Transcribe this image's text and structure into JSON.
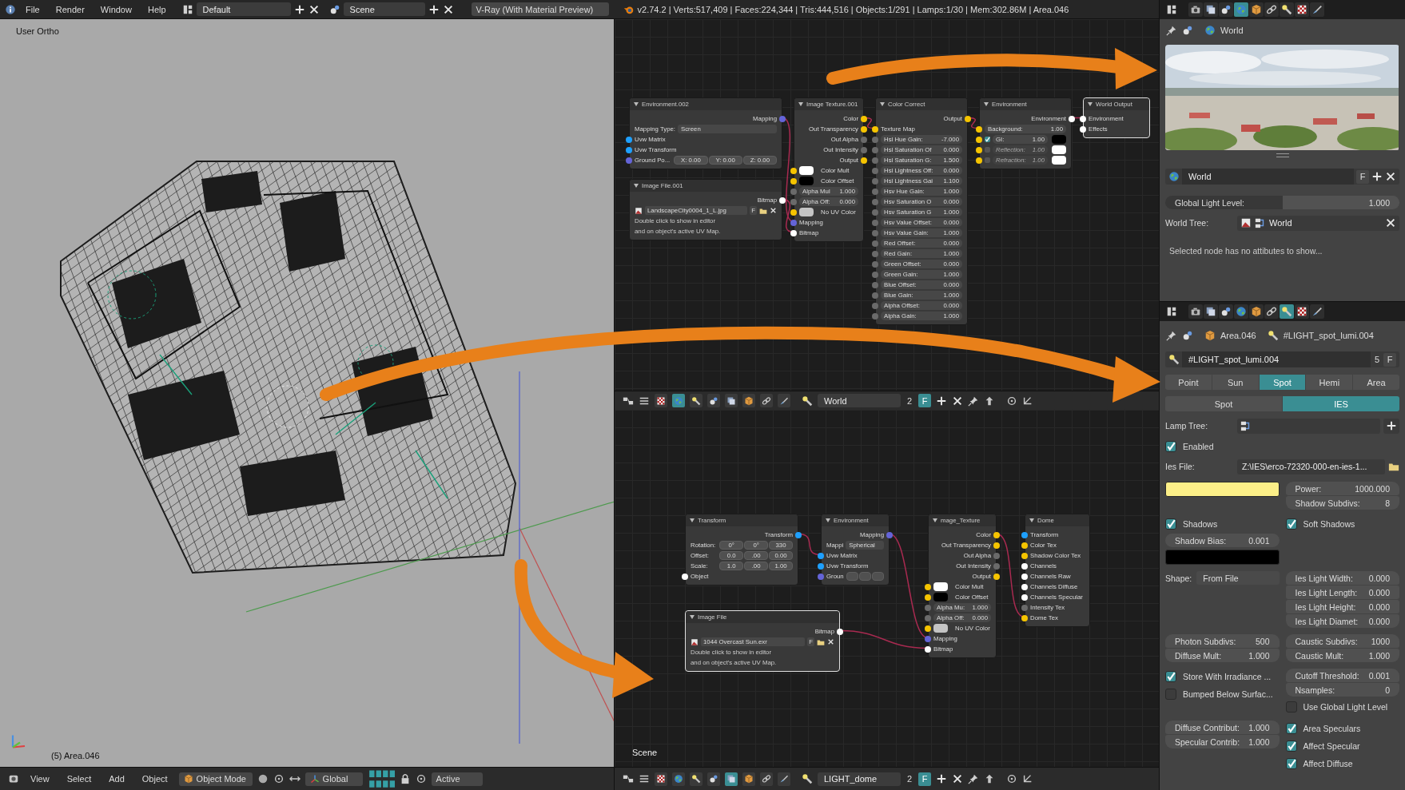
{
  "top_bar": {
    "menus": [
      "File",
      "Render",
      "Window",
      "Help"
    ],
    "layout": "Default",
    "scene": "Scene",
    "engine": "V-Ray (With Material Preview)",
    "stats": "v2.74.2 | Verts:517,409 | Faces:224,344 | Tris:444,516 | Objects:1/291 | Lamps:1/30 | Mem:302.86M | Area.046"
  },
  "viewport": {
    "view_name": "User Ortho",
    "object_info": "(5) Area.046",
    "footer": {
      "menus": [
        "View",
        "Select",
        "Add",
        "Object"
      ],
      "mode": "Object Mode",
      "orientation": "Global",
      "pivot": "Active"
    }
  },
  "node_editors": [
    {
      "nodes": [
        {
          "title": "Environment.002",
          "selected": false,
          "rows": [
            {
              "kind": "out",
              "label": "Mapping",
              "socket": {
                "color": "#6464d8"
              }
            },
            {
              "kind": "select",
              "label": "Mapping Type:",
              "value": "Screen"
            },
            {
              "kind": "in",
              "label": "Uvw Matrix",
              "socket": {
                "color": "#1ea0ff"
              }
            },
            {
              "kind": "in",
              "label": "Uvw Transform",
              "socket": {
                "color": "#1ea0ff"
              }
            },
            {
              "kind": "vec",
              "label": "Ground Po...",
              "values": [
                "X: 0.00",
                "Y: 0.00",
                "Z: 0.00"
              ],
              "socket": {
                "color": "#6464d8"
              }
            }
          ]
        },
        {
          "title": "Image File.001",
          "selected": false,
          "rows": [
            {
              "kind": "out",
              "label": "Bitmap",
              "socket": {
                "color": "#ffffff"
              }
            },
            {
              "kind": "file",
              "value": "LandscapeCity0004_1_L.jpg",
              "flag": "F"
            },
            {
              "kind": "note",
              "label": "Double click to show in editor"
            },
            {
              "kind": "note",
              "label": "and on object's active UV Map."
            }
          ]
        },
        {
          "title": "Image Texture.001",
          "selected": false,
          "rows": [
            {
              "kind": "out",
              "label": "Color",
              "socket": {
                "color": "#f5c400"
              }
            },
            {
              "kind": "out",
              "label": "Out Transparency",
              "socket": {
                "color": "#f5c400"
              }
            },
            {
              "kind": "out",
              "label": "Out Alpha",
              "socket": {
                "color": "#6a6a6a"
              }
            },
            {
              "kind": "out",
              "label": "Out Intensity",
              "socket": {
                "color": "#6a6a6a"
              }
            },
            {
              "kind": "out",
              "label": "Output",
              "socket": {
                "color": "#f5c400"
              }
            },
            {
              "kind": "swatch",
              "label": "Color Mult",
              "swatch": {
                "color": "#ffffff"
              },
              "socket": {
                "color": "#f5c400"
              }
            },
            {
              "kind": "swatch",
              "label": "Color Offset",
              "swatch": {
                "color": "#000000"
              },
              "socket": {
                "color": "#f5c400"
              }
            },
            {
              "kind": "prop",
              "label": "Alpha Mul",
              "value": "1.000",
              "socket": {
                "color": "#6a6a6a"
              }
            },
            {
              "kind": "prop",
              "label": "Alpha Off:",
              "value": "0.000",
              "socket": {
                "color": "#6a6a6a"
              }
            },
            {
              "kind": "swatch",
              "label": "No UV Color",
              "swatch": {
                "color": "#c4c4c4"
              },
              "socket": {
                "color": "#f5c400"
              }
            },
            {
              "kind": "in",
              "label": "Mapping",
              "socket": {
                "color": "#6464d8"
              }
            },
            {
              "kind": "in",
              "label": "Bitmap",
              "socket": {
                "color": "#ffffff"
              }
            }
          ]
        },
        {
          "title": "Color Correct",
          "selected": false,
          "rows": [
            {
              "kind": "out",
              "label": "Output",
              "socket": {
                "color": "#f5c400"
              }
            },
            {
              "kind": "in",
              "label": "Texture Map",
              "socket": {
                "color": "#f5c400"
              }
            },
            {
              "kind": "prop",
              "label": "Hsl Hue Gain:",
              "value": "-7.000",
              "socket": {
                "color": "#6a6a6a"
              }
            },
            {
              "kind": "prop",
              "label": "Hsl Saturation Of",
              "value": "0.000",
              "socket": {
                "color": "#6a6a6a"
              }
            },
            {
              "kind": "prop",
              "label": "Hsl Saturation G:",
              "value": "1.500",
              "socket": {
                "color": "#6a6a6a"
              }
            },
            {
              "kind": "prop",
              "label": "Hsl Lightness Off:",
              "value": "0.000",
              "socket": {
                "color": "#6a6a6a"
              }
            },
            {
              "kind": "prop",
              "label": "Hsl Lightness Gai",
              "value": "1.100",
              "socket": {
                "color": "#6a6a6a"
              }
            },
            {
              "kind": "prop",
              "label": "Hsv Hue Gain:",
              "value": "1.000",
              "socket": {
                "color": "#6a6a6a"
              }
            },
            {
              "kind": "prop",
              "label": "Hsv Saturation O",
              "value": "0.000",
              "socket": {
                "color": "#6a6a6a"
              }
            },
            {
              "kind": "prop",
              "label": "Hsv Saturation G",
              "value": "1.000",
              "socket": {
                "color": "#6a6a6a"
              }
            },
            {
              "kind": "prop",
              "label": "Hsv Value Offset:",
              "value": "0.000",
              "socket": {
                "color": "#6a6a6a"
              }
            },
            {
              "kind": "prop",
              "label": "Hsv Value Gain:",
              "value": "1.000",
              "socket": {
                "color": "#6a6a6a"
              }
            },
            {
              "kind": "prop",
              "label": "Red Offset:",
              "value": "0.000",
              "socket": {
                "color": "#6a6a6a"
              }
            },
            {
              "kind": "prop",
              "label": "Red Gain:",
              "value": "1.000",
              "socket": {
                "color": "#6a6a6a"
              }
            },
            {
              "kind": "prop",
              "label": "Green Offset:",
              "value": "0.000",
              "socket": {
                "color": "#6a6a6a"
              }
            },
            {
              "kind": "prop",
              "label": "Green Gain:",
              "value": "1.000",
              "socket": {
                "color": "#6a6a6a"
              }
            },
            {
              "kind": "prop",
              "label": "Blue Offset:",
              "value": "0.000",
              "socket": {
                "color": "#6a6a6a"
              }
            },
            {
              "kind": "prop",
              "label": "Blue Gain:",
              "value": "1.000",
              "socket": {
                "color": "#6a6a6a"
              }
            },
            {
              "kind": "prop",
              "label": "Alpha Offset:",
              "value": "0.000",
              "socket": {
                "color": "#6a6a6a"
              }
            },
            {
              "kind": "prop",
              "label": "Alpha Gain:",
              "value": "1.000",
              "socket": {
                "color": "#6a6a6a"
              }
            }
          ]
        },
        {
          "title": "Environment",
          "selected": false,
          "rows": [
            {
              "kind": "out",
              "label": "Environment",
              "socket": {
                "color": "#ffffff"
              }
            },
            {
              "kind": "prop",
              "label": "Background:",
              "value": "1.00",
              "socket": {
                "color": "#f5c400"
              }
            },
            {
              "kind": "toggle",
              "label": "GI:",
              "value": "1.00",
              "checked": true,
              "swatch": {
                "color": "#000000"
              },
              "socket": {
                "color": "#f5c400"
              }
            },
            {
              "kind": "toggle",
              "label": "Reflection:",
              "value": "1.00",
              "checked": false,
              "swatch": {
                "color": "#ffffff"
              },
              "socket": {
                "color": "#f5c400"
              }
            },
            {
              "kind": "toggle",
              "label": "Refraction:",
              "value": "1.00",
              "checked": false,
              "swatch": {
                "color": "#ffffff"
              },
              "socket": {
                "color": "#f5c400"
              }
            }
          ]
        },
        {
          "title": "World Output",
          "selected": true,
          "rows": [
            {
              "kind": "in",
              "label": "Environment",
              "socket": {
                "color": "#ffffff"
              }
            },
            {
              "kind": "in",
              "label": "Effects",
              "socket": {
                "color": "#ffffff"
              }
            }
          ]
        }
      ],
      "header": {
        "tree_types": [
          {
            "kind": "texture",
            "selected": false
          },
          {
            "kind": "world",
            "selected": true
          },
          {
            "kind": "lamp",
            "selected": false
          },
          {
            "kind": "scene",
            "selected": false
          },
          {
            "kind": "layers",
            "selected": false
          },
          {
            "kind": "object",
            "selected": false
          },
          {
            "kind": "constraint",
            "selected": false
          },
          {
            "kind": "particles",
            "selected": false
          }
        ],
        "datablock": "World",
        "users": "2",
        "fake_user": "F",
        "fake_on": true
      }
    },
    {
      "canvas_label": "Scene",
      "nodes": [
        {
          "title": "Transform",
          "selected": false,
          "rows": [
            {
              "kind": "out",
              "label": "Transform",
              "socket": {
                "color": "#1ea0ff"
              }
            },
            {
              "kind": "vec",
              "label": "Rotation:",
              "values": [
                "0°",
                "0°",
                "330"
              ]
            },
            {
              "kind": "vec",
              "label": "Offset:",
              "values": [
                "0.0",
                ".00",
                "0.00"
              ]
            },
            {
              "kind": "vec",
              "label": "Scale:",
              "values": [
                "1.0",
                ".00",
                "1.00"
              ]
            },
            {
              "kind": "in",
              "label": "Object",
              "socket": {
                "color": "#ffffff"
              }
            }
          ]
        },
        {
          "title": "Environment",
          "selected": false,
          "rows": [
            {
              "kind": "out",
              "label": "Mapping",
              "socket": {
                "color": "#6464d8"
              }
            },
            {
              "kind": "select",
              "label": "Mappi",
              "value": "Spherical"
            },
            {
              "kind": "in",
              "label": "Uvw Matrix",
              "socket": {
                "color": "#1ea0ff"
              }
            },
            {
              "kind": "in",
              "label": "Uvw Transform",
              "socket": {
                "color": "#1ea0ff"
              }
            },
            {
              "kind": "vec",
              "label": "Groun",
              "socket": {
                "color": "#6464d8"
              }
            }
          ]
        },
        {
          "title": "mage_Texture",
          "selected": false,
          "rows": [
            {
              "kind": "out",
              "label": "Color",
              "socket": {
                "color": "#f5c400"
              }
            },
            {
              "kind": "out",
              "label": "Out Transparency",
              "socket": {
                "color": "#f5c400"
              }
            },
            {
              "kind": "out",
              "label": "Out Alpha",
              "socket": {
                "color": "#6a6a6a"
              }
            },
            {
              "kind": "out",
              "label": "Out Intensity",
              "socket": {
                "color": "#6a6a6a"
              }
            },
            {
              "kind": "out",
              "label": "Output",
              "socket": {
                "color": "#f5c400"
              }
            },
            {
              "kind": "swatch",
              "label": "Color Mult",
              "swatch": {
                "color": "#ffffff"
              },
              "socket": {
                "color": "#f5c400"
              }
            },
            {
              "kind": "swatch",
              "label": "Color Offset",
              "swatch": {
                "color": "#000000"
              },
              "socket": {
                "color": "#f5c400"
              }
            },
            {
              "kind": "prop",
              "label": "Alpha Mu:",
              "value": "1.000",
              "socket": {
                "color": "#6a6a6a"
              }
            },
            {
              "kind": "prop",
              "label": "Alpha Off:",
              "value": "0.000",
              "socket": {
                "color": "#6a6a6a"
              }
            },
            {
              "kind": "swatch",
              "label": "No UV Color",
              "swatch": {
                "color": "#c4c4c4"
              },
              "socket": {
                "color": "#f5c400"
              }
            },
            {
              "kind": "in",
              "label": "Mapping",
              "socket": {
                "color": "#6464d8"
              }
            },
            {
              "kind": "in",
              "label": "Bitmap",
              "socket": {
                "color": "#ffffff"
              }
            }
          ]
        },
        {
          "title": "Dome",
          "selected": false,
          "rows": [
            {
              "kind": "in",
              "label": "Transform",
              "socket": {
                "color": "#1ea0ff"
              }
            },
            {
              "kind": "in",
              "label": "Color Tex",
              "socket": {
                "color": "#f5c400"
              }
            },
            {
              "kind": "in",
              "label": "Shadow Color Tex",
              "socket": {
                "color": "#f5c400"
              }
            },
            {
              "kind": "in",
              "label": "Channels",
              "socket": {
                "color": "#ffffff"
              }
            },
            {
              "kind": "in",
              "label": "Channels Raw",
              "socket": {
                "color": "#ffffff"
              }
            },
            {
              "kind": "in",
              "label": "Channels Diffuse",
              "socket": {
                "color": "#ffffff"
              }
            },
            {
              "kind": "in",
              "label": "Channels Specular",
              "socket": {
                "color": "#ffffff"
              }
            },
            {
              "kind": "in",
              "label": "Intensity Tex",
              "socket": {
                "color": "#6a6a6a"
              }
            },
            {
              "kind": "in",
              "label": "Dome Tex",
              "socket": {
                "color": "#f5c400"
              }
            }
          ]
        },
        {
          "title": "Image File",
          "selected": true,
          "rows": [
            {
              "kind": "out",
              "label": "Bitmap",
              "socket": {
                "color": "#ffffff"
              }
            },
            {
              "kind": "file",
              "value": "1044 Overcast Sun.exr",
              "flag": "F"
            },
            {
              "kind": "note",
              "label": "Double click to show in editor"
            },
            {
              "kind": "note",
              "label": "and on object's active UV Map."
            }
          ]
        }
      ],
      "header": {
        "tree_types": [
          {
            "kind": "texture",
            "selected": false
          },
          {
            "kind": "world",
            "selected": false
          },
          {
            "kind": "lamp",
            "selected": false
          },
          {
            "kind": "scene",
            "selected": false
          },
          {
            "kind": "layers",
            "selected": true
          },
          {
            "kind": "object",
            "selected": false
          },
          {
            "kind": "constraint",
            "selected": false
          },
          {
            "kind": "particles",
            "selected": false
          }
        ],
        "datablock": "LIGHT_dome",
        "users": "2",
        "fake_user": "F",
        "fake_on": true
      }
    }
  ],
  "world_properties": {
    "tabs": [
      {
        "kind": "render",
        "selected": false
      },
      {
        "kind": "layers",
        "selected": false
      },
      {
        "kind": "scene",
        "selected": false
      },
      {
        "kind": "world",
        "selected": true
      },
      {
        "kind": "object",
        "selected": false
      },
      {
        "kind": "constraint",
        "selected": false
      },
      {
        "kind": "lamp",
        "selected": false
      },
      {
        "kind": "texture",
        "selected": false
      },
      {
        "kind": "particles",
        "selected": false
      }
    ],
    "path": [
      {
        "kind": "world",
        "label": "World"
      }
    ],
    "datablock": {
      "name": "World",
      "fake_user": "F",
      "fake_on": false
    },
    "light_level": {
      "label": "Global Light Level:",
      "value": "1.000"
    },
    "tree": {
      "label": "World Tree:",
      "value": "World"
    },
    "message": "Selected node has no attibutes to show..."
  },
  "lamp_properties": {
    "tabs": [
      {
        "kind": "render",
        "selected": false
      },
      {
        "kind": "layers",
        "selected": false
      },
      {
        "kind": "scene",
        "selected": false
      },
      {
        "kind": "world",
        "selected": false
      },
      {
        "kind": "object",
        "selected": false
      },
      {
        "kind": "constraint",
        "selected": false
      },
      {
        "kind": "lamp",
        "selected": true
      },
      {
        "kind": "texture",
        "selected": false
      },
      {
        "kind": "particles",
        "selected": false
      }
    ],
    "path": [
      {
        "kind": "object",
        "label": "Area.046"
      },
      {
        "kind": "lamp",
        "label": "#LIGHT_spot_lumi.004"
      }
    ],
    "datablock": {
      "name": "#LIGHT_spot_lumi.004",
      "users": "5",
      "fake_user": "F",
      "fake_on": false
    },
    "lamp_types": [
      {
        "label": "Point",
        "selected": false
      },
      {
        "label": "Sun",
        "selected": false
      },
      {
        "label": "Spot",
        "selected": true
      },
      {
        "label": "Hemi",
        "selected": false
      },
      {
        "label": "Area",
        "selected": false
      }
    ],
    "modes": [
      {
        "label": "Spot",
        "selected": false
      },
      {
        "label": "IES",
        "selected": true
      }
    ],
    "lamp_tree": {
      "label": "Lamp Tree:"
    },
    "enabled": {
      "label": "Enabled",
      "checked": true
    },
    "ies_file": {
      "label": "Ies File:",
      "value": "Z:\\IES\\erco-72320-000-en-ies-1..."
    },
    "sections": [
      {
        "left": [
          {
            "kind": "swatch",
            "swatch": {
              "color": "#fcef88"
            }
          }
        ],
        "right": [
          {
            "kind": "nums",
            "items": [
              {
                "label": "Power:",
                "value": "1000.000"
              },
              {
                "label": "Shadow Subdivs:",
                "value": "8"
              }
            ]
          }
        ]
      },
      {
        "left": [
          {
            "kind": "check",
            "label": "Shadows",
            "checked": true
          },
          {
            "kind": "nums",
            "items": [
              {
                "label": "Shadow Bias:",
                "value": "0.001"
              }
            ]
          },
          {
            "kind": "swatch",
            "swatch": {
              "color": "#000000"
            }
          }
        ],
        "right": [
          {
            "kind": "check",
            "label": "Soft Shadows",
            "checked": true
          }
        ]
      },
      {
        "left": [
          {
            "kind": "select",
            "label": "Shape:",
            "value": "From File"
          }
        ],
        "right": [
          {
            "kind": "nums",
            "items": [
              {
                "label": "Ies Light Width:",
                "value": "0.000"
              },
              {
                "label": "Ies Light Length:",
                "value": "0.000"
              },
              {
                "label": "Ies Light Height:",
                "value": "0.000"
              },
              {
                "label": "Ies Light Diamet:",
                "value": "0.000"
              }
            ]
          }
        ]
      },
      {
        "left": [
          {
            "kind": "nums",
            "items": [
              {
                "label": "Photon Subdivs:",
                "value": "500"
              },
              {
                "label": "Diffuse Mult:",
                "value": "1.000"
              }
            ]
          }
        ],
        "right": [
          {
            "kind": "nums",
            "items": [
              {
                "label": "Caustic Subdivs:",
                "value": "1000"
              },
              {
                "label": "Caustic Mult:",
                "value": "1.000"
              }
            ]
          }
        ]
      },
      {
        "left": [
          {
            "kind": "check",
            "label": "Store With Irradiance ...",
            "checked": true
          },
          {
            "kind": "check",
            "label": "Bumped Below Surfac...",
            "checked": false
          }
        ],
        "right": [
          {
            "kind": "nums",
            "items": [
              {
                "label": "Cutoff Threshold:",
                "value": "0.001"
              },
              {
                "label": "Nsamples:",
                "value": "0"
              }
            ]
          },
          {
            "kind": "check",
            "label": "Use Global Light Level",
            "checked": false
          }
        ]
      },
      {
        "left": [
          {
            "kind": "nums",
            "items": [
              {
                "label": "Diffuse Contribut:",
                "value": "1.000"
              },
              {
                "label": "Specular Contrib:",
                "value": "1.000"
              }
            ]
          }
        ],
        "right": [
          {
            "kind": "check",
            "label": "Area Speculars",
            "checked": true
          },
          {
            "kind": "check",
            "label": "Affect Specular",
            "checked": true
          },
          {
            "kind": "check",
            "label": "Affect Diffuse",
            "checked": true
          }
        ]
      }
    ]
  }
}
